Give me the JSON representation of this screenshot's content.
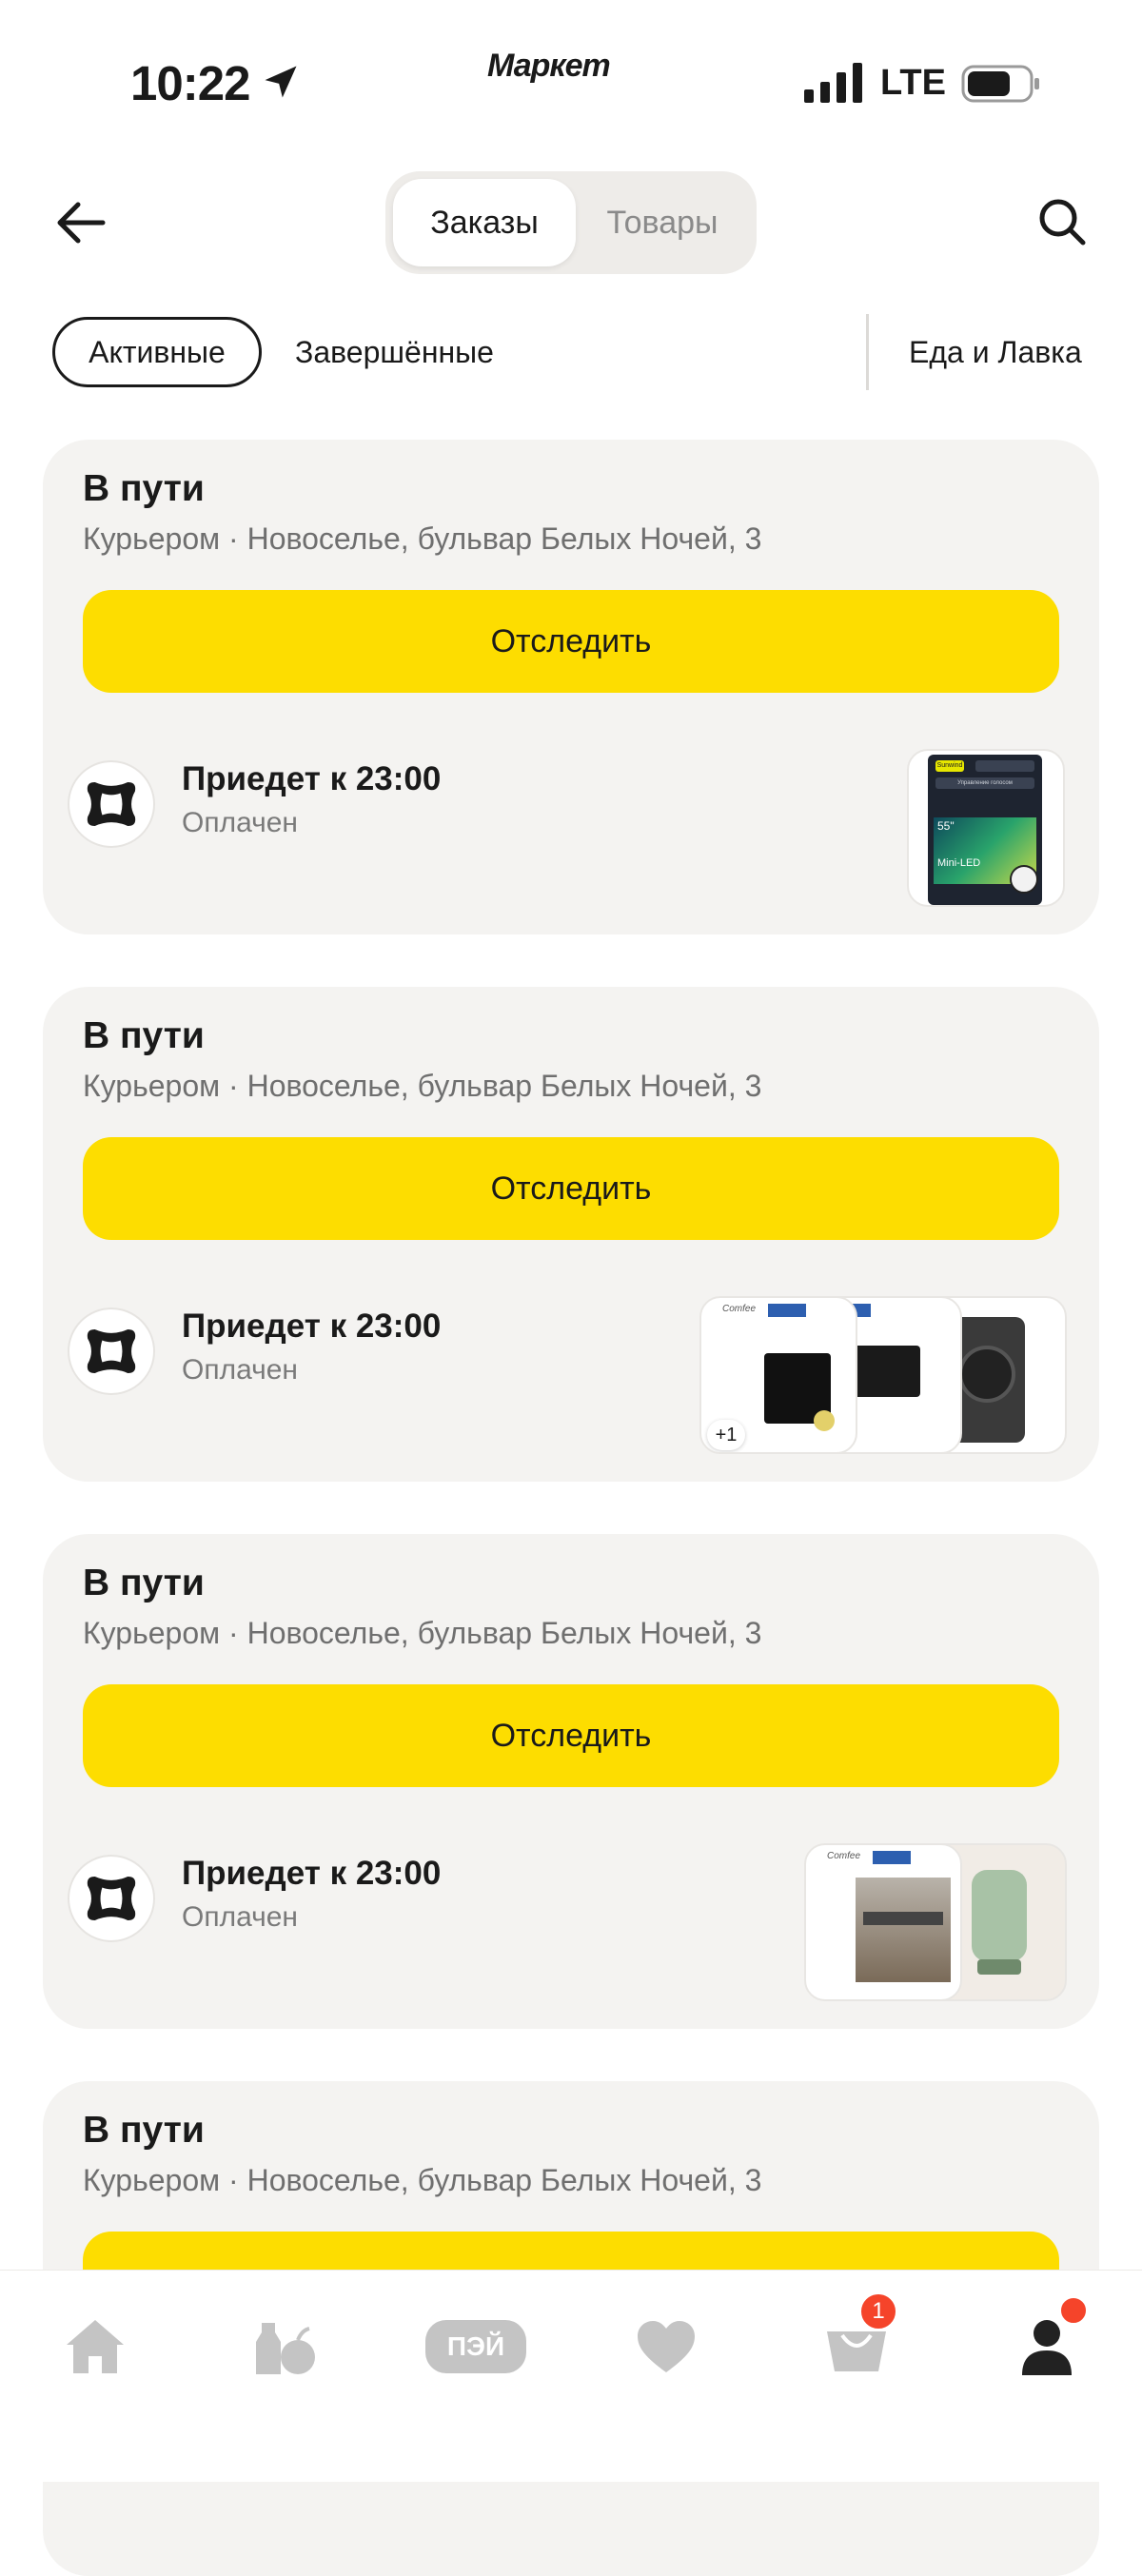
{
  "status_bar": {
    "time": "10:22",
    "brand": "Маркет",
    "network": "LTE"
  },
  "header": {
    "tabs": [
      {
        "label": "Заказы",
        "active": true
      },
      {
        "label": "Товары",
        "active": false
      }
    ]
  },
  "filters": {
    "active": "Активные",
    "completed": "Завершённые",
    "food": "Еда и Лавка"
  },
  "orders": [
    {
      "status": "В пути",
      "address": "Курьером · Новоселье, бульвар Белых Ночей, 3",
      "track_label": "Отследить",
      "eta": "Приедет к 23:00",
      "payment": "Оплачен",
      "thumb_labels": [
        "Sunwind",
        "Управление голосом",
        "55\"",
        "Mini-LED"
      ]
    },
    {
      "status": "В пути",
      "address": "Курьером · Новоселье, бульвар Белых Ночей, 3",
      "track_label": "Отследить",
      "eta": "Приедет к 23:00",
      "payment": "Оплачен",
      "thumb_labels": [
        "Comfee",
        "Comfee"
      ],
      "extra_count": "+1"
    },
    {
      "status": "В пути",
      "address": "Курьером · Новоселье, бульвар Белых Ночей, 3",
      "track_label": "Отследить",
      "eta": "Приедет к 23:00",
      "payment": "Оплачен",
      "thumb_labels": [
        "Comfee"
      ]
    },
    {
      "status": "В пути",
      "address": "Курьером · Новоселье, бульвар Белых Ночей, 3",
      "track_label": "Отследить"
    }
  ],
  "bottom_nav": {
    "items": [
      "home-icon",
      "grocery-icon",
      "pay-icon",
      "favorites-icon",
      "cart-icon",
      "profile-icon"
    ],
    "pay_label": "ПЭЙ",
    "cart_badge": "1"
  },
  "colors": {
    "accent": "#fddd00",
    "badge": "#f5442a",
    "card_bg": "#f4f3f1"
  }
}
